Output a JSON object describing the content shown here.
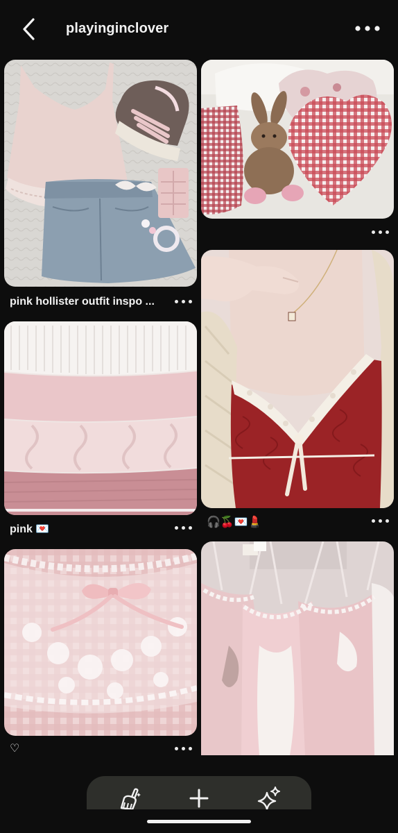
{
  "header": {
    "title": "playinginclover",
    "back_icon": "chevron-left-icon",
    "more_icon": "more-horizontal-icon"
  },
  "pins": [
    {
      "id": "pin-outfit",
      "caption": "pink hollister outfit inspo ...",
      "image": "pink camisole, denim mini skirt and sneakers flat lay"
    },
    {
      "id": "pin-bunny",
      "caption": "",
      "image": "stuffed bunny with gingham heart pillows"
    },
    {
      "id": "pin-sweaters",
      "caption": "pink 💌",
      "image": "stack of pink knit sweaters"
    },
    {
      "id": "pin-red-cami",
      "caption": "🎧🍒💌💄",
      "image": "red lace camisole with cream cardigan"
    },
    {
      "id": "pin-lace-bow",
      "caption": "♡",
      "image": "pink gingham with white lace and satin bow"
    },
    {
      "id": "pin-slips",
      "caption": "",
      "image": "pink and white lace slip dresses on hangers"
    }
  ],
  "bottom_bar": {
    "left_icon": "broom-sparkle-icon",
    "center_icon": "plus-icon",
    "right_icon": "sparkles-icon"
  },
  "colors": {
    "background": "#0d0d0d",
    "text": "#f2f2f2",
    "bar": "#2e2f2b"
  }
}
